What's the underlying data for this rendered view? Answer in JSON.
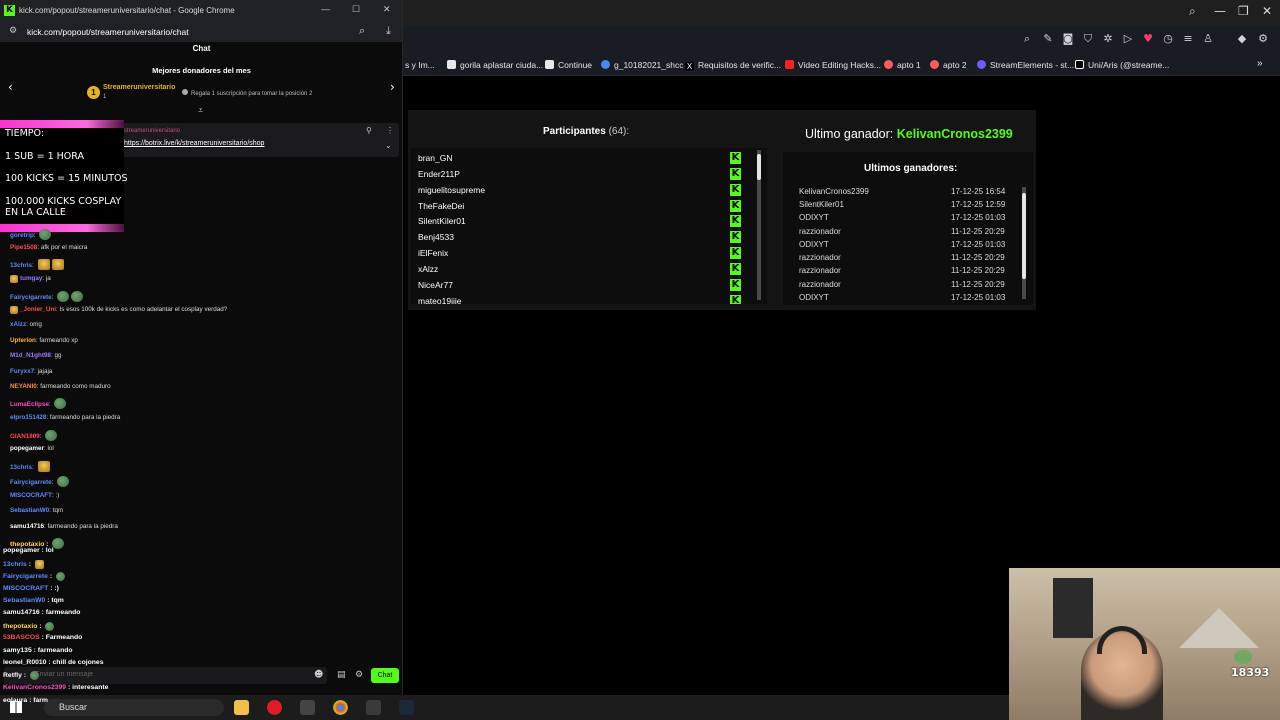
{
  "chat_window": {
    "title": "kick.com/popout/streameruniversitario/chat - Google Chrome",
    "url": "kick.com/popout/streameruniversitario/chat",
    "header": "Chat",
    "top_donors_title": "Mejores donadores del mes",
    "donor_rank": "1",
    "donor_name": "Streameruniversitario",
    "donor_count": "1",
    "donor_info": "Regala 1 suscripción para tomar la posición 2",
    "pinned_user": "streameruniversitario",
    "pinned_link": "https://botrix.live/k/streameruniversitario/shop",
    "input_placeholder": "Enviar un mensaje",
    "chat_button": "Chat"
  },
  "overlay": {
    "lines": [
      "TIEMPO:",
      "1 SUB = 1 HORA",
      "100 KICKS = 15 MINUTOS",
      "100.000 KICKS COSPLAY",
      "EN LA CALLE"
    ]
  },
  "chat_messages": [
    {
      "user": "goretrip",
      "color": "#5b8cff",
      "text": ""
    },
    {
      "user": "Pipe1508",
      "color": "#ff4d4d",
      "text": "afk por el maicra"
    },
    {
      "user": "13chris",
      "color": "#5b8cff",
      "text": ""
    },
    {
      "user": "tumgay",
      "color": "#9b7bff",
      "text": "ja"
    },
    {
      "user": "Fairycigarrete",
      "color": "#5b8cff",
      "text": ""
    },
    {
      "user": "_Jonier_Uni",
      "color": "#ff4d4d",
      "text": "Is esos 100k de kicks es como adelantar el cosplay verdad?"
    },
    {
      "user": "xAlzz",
      "color": "#5b8cff",
      "text": "omg"
    },
    {
      "user": "Upterion",
      "color": "#ffb43c",
      "text": "farmeando xp"
    },
    {
      "user": "M1d_N1ght98",
      "color": "#9b7bff",
      "text": "gg"
    },
    {
      "user": "Furyxx7",
      "color": "#5b8cff",
      "text": "jajaja"
    },
    {
      "user": "NEYANI0",
      "color": "#ff8c3c",
      "text": "farmeando como maduro"
    },
    {
      "user": "LumaEclipse",
      "color": "#ff4dc4",
      "text": ""
    },
    {
      "user": "elpro151428",
      "color": "#5b8cff",
      "text": "farmeando para la piedra"
    },
    {
      "user": "GIAN1809",
      "color": "#ff4d4d",
      "text": ""
    },
    {
      "user": "popegamer",
      "color": "#ffffff",
      "text": "lol"
    },
    {
      "user": "13chris",
      "color": "#5b8cff",
      "text": ""
    },
    {
      "user": "Fairycigarrete",
      "color": "#5b8cff",
      "text": ""
    },
    {
      "user": "MISCOCRAFT",
      "color": "#5b8cff",
      "text": ":)"
    },
    {
      "user": "SebastianW0",
      "color": "#5b8cff",
      "text": "tqm"
    },
    {
      "user": "samu14716",
      "color": "#ffffff",
      "text": "farmeando para la piedra"
    }
  ],
  "obs_chat": [
    {
      "user": "thepotaxio",
      "color": "#ffd84d",
      "text": ""
    },
    {
      "user": "popegamer",
      "color": "#ffffff",
      "text": "lol"
    },
    {
      "user": "13chris",
      "color": "#5b8cff",
      "text": ""
    },
    {
      "user": "Fairycigarrete",
      "color": "#5b8cff",
      "text": ""
    },
    {
      "user": "MISCOCRAFT",
      "color": "#5b8cff",
      "text": ":)"
    },
    {
      "user": "SebastianW0",
      "color": "#5b8cff",
      "text": "tqm"
    },
    {
      "user": "samu14716",
      "color": "#ffffff",
      "text": "farmeando"
    },
    {
      "user": "thepotaxio",
      "color": "#ffd84d",
      "text": ""
    },
    {
      "user": "53BASCOS",
      "color": "#ff4d4d",
      "text": "Farmeando"
    },
    {
      "user": "samy135",
      "color": "#ffffff",
      "text": "farmeando"
    },
    {
      "user": "leonel_R0010",
      "color": "#ffffff",
      "text": "chill de cojones"
    },
    {
      "user": "Retfly",
      "color": "#ffffff",
      "text": ""
    },
    {
      "user": "KelivanCronos2399",
      "color": "#ff4dc4",
      "text": "interesante"
    },
    {
      "user": "eolaura",
      "color": "#ffffff",
      "text": "farm"
    }
  ],
  "bookmarks": [
    {
      "label": "s y Im...",
      "color": "#888888"
    },
    {
      "label": "gorila aplastar ciuda...",
      "color": "#e8e8e8"
    },
    {
      "label": "Continue",
      "color": "#e8e8e8"
    },
    {
      "label": "g_10182021_shcc",
      "color": "#3d8bff"
    },
    {
      "label": "Requisitos de verific...",
      "color": "#ffffff"
    },
    {
      "label": "Video Editing Hacks...",
      "color": "#ff2020"
    },
    {
      "label": "apto 1",
      "color": "#ff5a5f"
    },
    {
      "label": "apto 2",
      "color": "#ff5a5f"
    },
    {
      "label": "StreamElements - st...",
      "color": "#6c5cff"
    },
    {
      "label": "Uni/Aris (@streame...",
      "color": "#ffffff"
    }
  ],
  "giveaway": {
    "participants_label": "Participantes",
    "participants_count": "(64):",
    "participants": [
      "bran_GN",
      "Ender211P",
      "miguelitosupreme",
      "TheFakeDei",
      "SilentKiler01",
      "Benj4533",
      "iElFenix",
      "xAlzz",
      "NiceAr77",
      "mateo19jiie"
    ],
    "last_winner_label": "Ultimo ganador:",
    "last_winner_name": "KelivanCronos2399",
    "winners_title": "Ultimos ganadores:",
    "winners": [
      {
        "name": "KelivanCronos2399",
        "date": "17-12-25 16:54"
      },
      {
        "name": "SilentKiler01",
        "date": "17-12-25 12:59"
      },
      {
        "name": "ODIXYT",
        "date": "17-12-25 01:03"
      },
      {
        "name": "razzionador",
        "date": "11-12-25 20:29"
      },
      {
        "name": "ODIXYT",
        "date": "17-12-25 01:03"
      },
      {
        "name": "razzionador",
        "date": "11-12-25 20:29"
      },
      {
        "name": "razzionador",
        "date": "11-12-25 20:29"
      },
      {
        "name": "razzionador",
        "date": "11-12-25 20:29"
      },
      {
        "name": "ODIXYT",
        "date": "17-12-25 01:03"
      }
    ],
    "accent_color": "#53fc18"
  },
  "taskbar": {
    "search_label": "Buscar"
  },
  "webcam": {
    "counter": "18393"
  }
}
